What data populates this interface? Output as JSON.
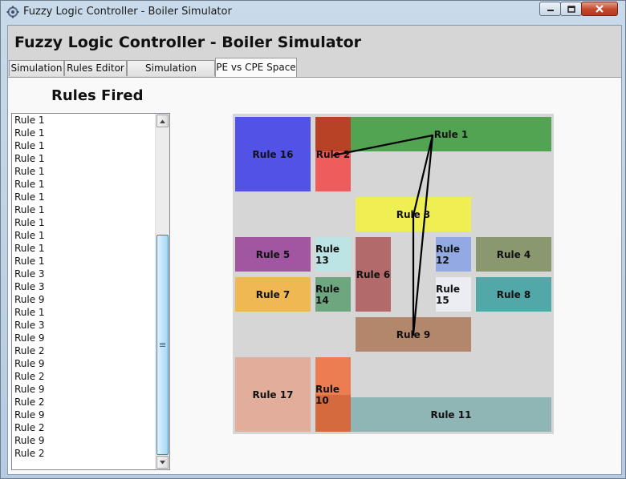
{
  "window": {
    "title": "Fuzzy Logic Controller - Boiler Simulator",
    "app_icon": "gear-icon",
    "controls": [
      "minimize-icon",
      "maximize-icon",
      "close-icon"
    ]
  },
  "header": {
    "title": "Fuzzy Logic Controller - Boiler Simulator"
  },
  "tabs": [
    {
      "label": "Simulation",
      "active": false
    },
    {
      "label": "Rules Editor",
      "active": false
    },
    {
      "label": "Simulation History",
      "active": false
    },
    {
      "label": "PE vs CPE Space",
      "active": true
    }
  ],
  "rules_fired": {
    "title": "Rules Fired",
    "items": [
      "Rule 1",
      "Rule 1",
      "Rule 1",
      "Rule 1",
      "Rule 1",
      "Rule 1",
      "Rule 1",
      "Rule 1",
      "Rule 1",
      "Rule 1",
      "Rule 1",
      "Rule 1",
      "Rule 3",
      "Rule 3",
      "Rule 9",
      "Rule 1",
      "Rule 3",
      "Rule 9",
      "Rule 2",
      "Rule 9",
      "Rule 2",
      "Rule 9",
      "Rule 2",
      "Rule 9",
      "Rule 2",
      "Rule 9",
      "Rule 2"
    ]
  },
  "space": {
    "rules": [
      {
        "label": "Rule 16",
        "color": "#5252e6"
      },
      {
        "label": "Rule 2",
        "color": "#ee5c5c",
        "accent": "#b84226"
      },
      {
        "label": "Rule 1",
        "color": "#52a352"
      },
      {
        "label": "Rule 3",
        "color": "#efee52"
      },
      {
        "label": "Rule 5",
        "color": "#a056a0"
      },
      {
        "label": "Rule 13",
        "color": "#bde4e4"
      },
      {
        "label": "Rule 6",
        "color": "#b36a6a"
      },
      {
        "label": "Rule 12",
        "color": "#92a9e3"
      },
      {
        "label": "Rule 4",
        "color": "#8a9870"
      },
      {
        "label": "Rule 7",
        "color": "#efb852"
      },
      {
        "label": "Rule 14",
        "color": "#6ea680"
      },
      {
        "label": "Rule 15",
        "color": "#ecedf2"
      },
      {
        "label": "Rule 8",
        "color": "#52a8a8"
      },
      {
        "label": "Rule 9",
        "color": "#b3876b"
      },
      {
        "label": "Rule 17",
        "color": "#e2ae9b"
      },
      {
        "label": "Rule 10",
        "color": "#ec7d52",
        "accent": "#d46a3e"
      },
      {
        "label": "Rule 11",
        "color": "#8fb5b5"
      }
    ],
    "trajectory_order": [
      "Rule 2",
      "Rule 1",
      "Rule 9",
      "Rule 1",
      "Rule 9",
      "Rule 1",
      "Rule 3",
      "Rule 9"
    ],
    "trajectory_color": "#000000"
  }
}
